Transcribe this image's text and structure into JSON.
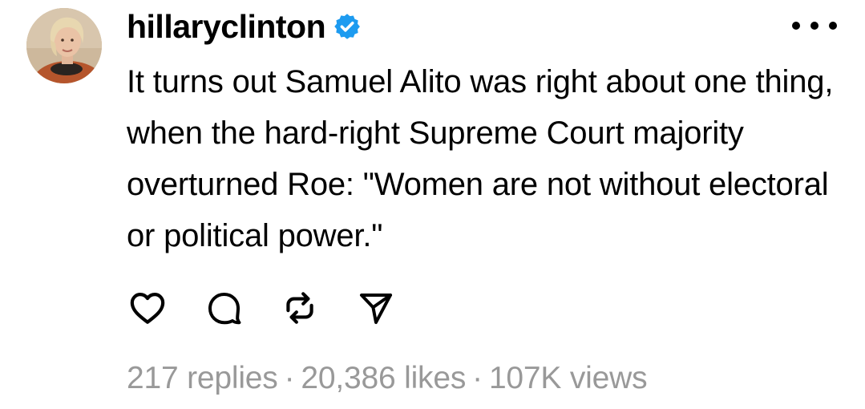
{
  "post": {
    "username": "hillaryclinton",
    "verified": true,
    "verified_color": "#1d9bf0",
    "text": "It turns out Samuel Alito was right about one thing, when the hard-right Supreme Court majority overturned Roe: \"Women are not without electoral or political power.\"",
    "actions": [
      {
        "name": "like",
        "icon": "heart-icon"
      },
      {
        "name": "reply",
        "icon": "comment-bubble-icon"
      },
      {
        "name": "repost",
        "icon": "repost-arrows-icon"
      },
      {
        "name": "share",
        "icon": "send-icon"
      }
    ],
    "stats": {
      "replies": "217 replies",
      "likes": "20,386 likes",
      "views": "107K views",
      "separator": "·"
    }
  },
  "colors": {
    "text": "#000000",
    "secondary_text": "#999999",
    "background": "#ffffff"
  }
}
